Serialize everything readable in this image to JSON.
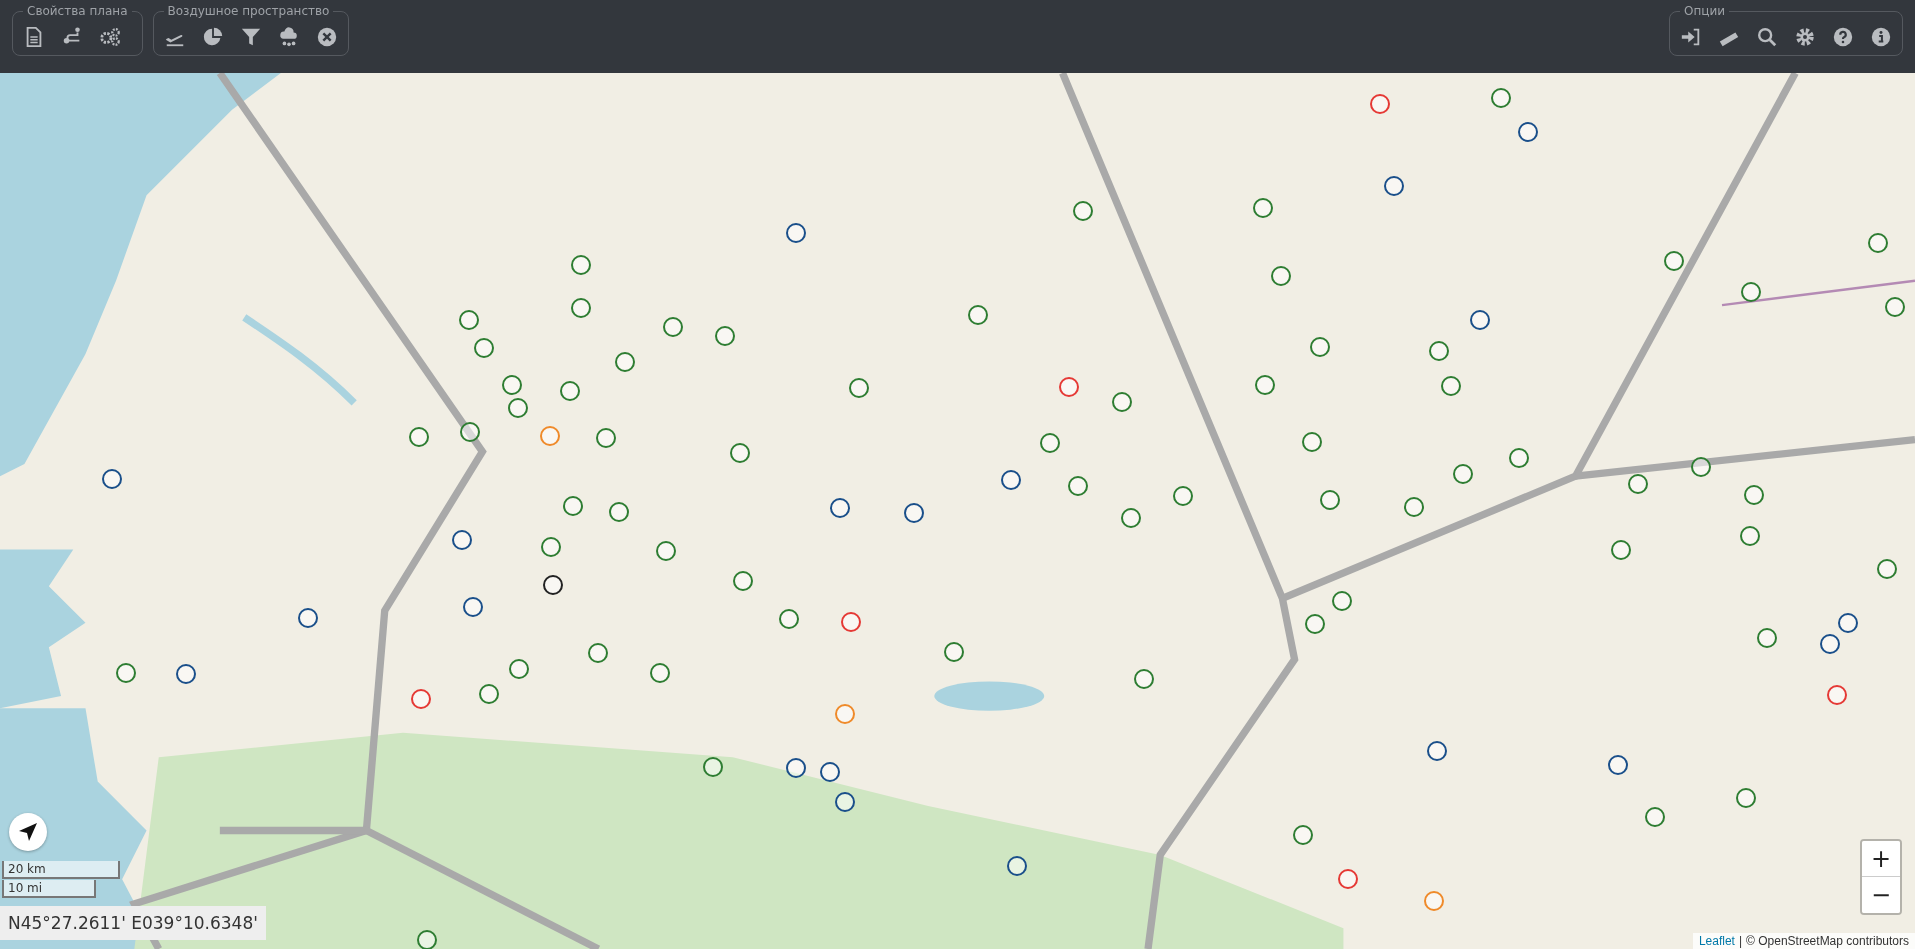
{
  "toolbar": {
    "groups": [
      {
        "legend": "Свойства плана",
        "buttons": [
          {
            "kind": "document"
          },
          {
            "kind": "route"
          },
          {
            "kind": "gears"
          }
        ]
      },
      {
        "legend": "Воздушное пространство",
        "buttons": [
          {
            "kind": "departure"
          },
          {
            "kind": "pie"
          },
          {
            "kind": "filter"
          },
          {
            "kind": "cloud"
          },
          {
            "kind": "close"
          }
        ]
      },
      {
        "legend": "Опции",
        "buttons": [
          {
            "kind": "login"
          },
          {
            "kind": "ruler"
          },
          {
            "kind": "search"
          },
          {
            "kind": "settings"
          },
          {
            "kind": "help"
          },
          {
            "kind": "info"
          }
        ]
      }
    ]
  },
  "map": {
    "markers": [
      {
        "color": "#2e7d32"
      },
      {
        "color": "#2e7d32"
      },
      {
        "color": "#2e7d32"
      },
      {
        "color": "#2e7d32"
      },
      {
        "color": "#2e7d32"
      },
      {
        "color": "#2e7d32"
      },
      {
        "color": "#2e7d32"
      },
      {
        "color": "#2e7d32"
      },
      {
        "color": "#2e7d32"
      },
      {
        "color": "#2e7d32"
      },
      {
        "color": "#2e7d32"
      },
      {
        "color": "#2e7d32"
      },
      {
        "color": "#2e7d32"
      },
      {
        "color": "#2e7d32"
      },
      {
        "color": "#2e7d32"
      },
      {
        "color": "#2e7d32"
      },
      {
        "color": "#2e7d32"
      },
      {
        "color": "#2e7d32"
      },
      {
        "color": "#2e7d32"
      },
      {
        "color": "#2e7d32"
      },
      {
        "color": "#2e7d32"
      },
      {
        "color": "#2e7d32"
      },
      {
        "color": "#2e7d32"
      },
      {
        "color": "#2e7d32"
      },
      {
        "color": "#2e7d32"
      },
      {
        "color": "#2e7d32"
      },
      {
        "color": "#2e7d32"
      },
      {
        "color": "#2e7d32"
      },
      {
        "color": "#2e7d32"
      },
      {
        "color": "#2e7d32"
      },
      {
        "color": "#2e7d32"
      },
      {
        "color": "#2e7d32"
      },
      {
        "color": "#2e7d32"
      },
      {
        "color": "#2e7d32"
      },
      {
        "color": "#2e7d32"
      },
      {
        "color": "#2e7d32"
      },
      {
        "color": "#2e7d32"
      },
      {
        "color": "#2e7d32"
      },
      {
        "color": "#2e7d32"
      },
      {
        "color": "#2e7d32"
      },
      {
        "color": "#2e7d32"
      },
      {
        "color": "#2e7d32"
      },
      {
        "color": "#2e7d32"
      },
      {
        "color": "#2e7d32"
      },
      {
        "color": "#2e7d32"
      },
      {
        "color": "#2e7d32"
      },
      {
        "color": "#2e7d32"
      },
      {
        "color": "#2e7d32"
      },
      {
        "color": "#2e7d32"
      },
      {
        "color": "#2e7d32"
      },
      {
        "color": "#2e7d32"
      },
      {
        "color": "#2e7d32"
      },
      {
        "color": "#2e7d32"
      },
      {
        "color": "#2e7d32"
      },
      {
        "color": "#2e7d32"
      },
      {
        "color": "#2e7d32"
      },
      {
        "color": "#2e7d32"
      },
      {
        "color": "#2e7d32"
      },
      {
        "color": "#2e7d32"
      },
      {
        "color": "#2e7d32"
      },
      {
        "color": "#2e7d32"
      },
      {
        "color": "#2e7d32"
      },
      {
        "color": "#2e7d32"
      },
      {
        "color": "#2e7d32"
      },
      {
        "color": "#2e7d32"
      },
      {
        "color": "#1a4f8a"
      },
      {
        "color": "#1a4f8a"
      },
      {
        "color": "#1a4f8a"
      },
      {
        "color": "#1a4f8a"
      },
      {
        "color": "#1a4f8a"
      },
      {
        "color": "#1a4f8a"
      },
      {
        "color": "#1a4f8a"
      },
      {
        "color": "#1a4f8a"
      },
      {
        "color": "#1a4f8a"
      },
      {
        "color": "#1a4f8a"
      },
      {
        "color": "#1a4f8a"
      },
      {
        "color": "#1a4f8a"
      },
      {
        "color": "#1a4f8a"
      },
      {
        "color": "#1a4f8a"
      },
      {
        "color": "#1a4f8a"
      },
      {
        "color": "#1a4f8a"
      },
      {
        "color": "#1a4f8a"
      },
      {
        "color": "#1a4f8a"
      },
      {
        "color": "#1a4f8a"
      },
      {
        "color": "#1a4f8a"
      },
      {
        "color": "#e53935"
      },
      {
        "color": "#e53935"
      },
      {
        "color": "#e53935"
      },
      {
        "color": "#e53935"
      },
      {
        "color": "#e53935"
      },
      {
        "color": "#e53935"
      },
      {
        "color": "#ef8a2a"
      },
      {
        "color": "#ef8a2a"
      },
      {
        "color": "#ef8a2a"
      },
      {
        "color": "#222222"
      }
    ],
    "scale": [
      "20 km",
      "10 mi"
    ],
    "coordinates": "N45°27.2611' E039°10.6348'",
    "zoom": {
      "in": "+",
      "out": "−"
    },
    "attribution": {
      "link": "Leaflet",
      "separator": "|",
      "text": "© OpenStreetMap contributors"
    }
  }
}
